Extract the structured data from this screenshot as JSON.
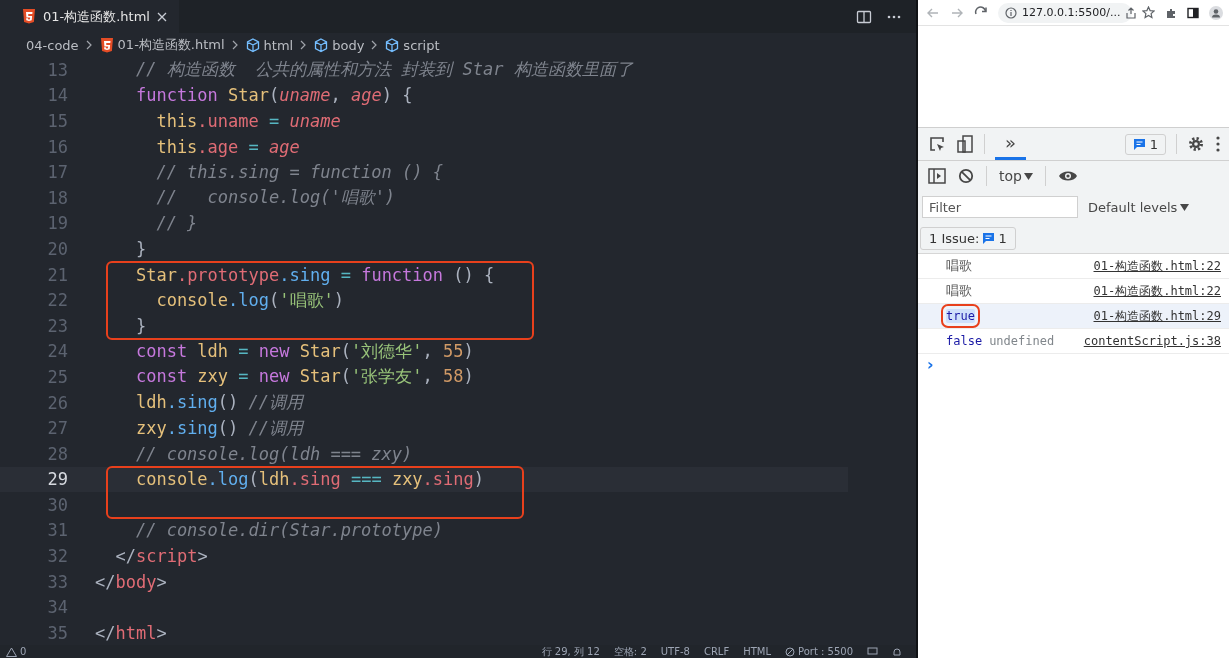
{
  "editor": {
    "tabs": [
      {
        "label": "01-构造函数.html",
        "selected": true
      }
    ],
    "breadcrumbs": [
      {
        "kind": "folder",
        "label": "04-code"
      },
      {
        "kind": "file",
        "label": "01-构造函数.html"
      },
      {
        "kind": "element",
        "label": "html"
      },
      {
        "kind": "element",
        "label": "body"
      },
      {
        "kind": "element",
        "label": "script"
      }
    ],
    "lines": [
      {
        "number": "13",
        "current": false,
        "boxed": false,
        "tokens": [
          {
            "kind": "comment",
            "text": "    // 构造函数  公共的属性和方法 封装到 Star 构造函数里面了"
          }
        ]
      },
      {
        "number": "14",
        "current": false,
        "boxed": false,
        "tokens": [
          {
            "kind": "keyword",
            "text": "    function"
          },
          {
            "kind": "class",
            "text": " Star"
          },
          {
            "kind": "punct",
            "text": "("
          },
          {
            "kind": "param",
            "text": "uname"
          },
          {
            "kind": "punct",
            "text": ", "
          },
          {
            "kind": "param",
            "text": "age"
          },
          {
            "kind": "punct",
            "text": ") {"
          }
        ]
      },
      {
        "number": "15",
        "current": false,
        "boxed": false,
        "tokens": [
          {
            "kind": "this",
            "text": "      this"
          },
          {
            "kind": "property",
            "text": ".uname"
          },
          {
            "kind": "operator",
            "text": " = "
          },
          {
            "kind": "param",
            "text": "uname"
          }
        ]
      },
      {
        "number": "16",
        "current": false,
        "boxed": false,
        "tokens": [
          {
            "kind": "this",
            "text": "      this"
          },
          {
            "kind": "property",
            "text": ".age"
          },
          {
            "kind": "operator",
            "text": " = "
          },
          {
            "kind": "param",
            "text": "age"
          }
        ]
      },
      {
        "number": "17",
        "current": false,
        "boxed": false,
        "tokens": [
          {
            "kind": "comment",
            "text": "      // this.sing = function () {"
          }
        ]
      },
      {
        "number": "18",
        "current": false,
        "boxed": false,
        "tokens": [
          {
            "kind": "comment",
            "text": "      //   console.log('唱歌')"
          }
        ]
      },
      {
        "number": "19",
        "current": false,
        "boxed": false,
        "tokens": [
          {
            "kind": "comment",
            "text": "      // }"
          }
        ]
      },
      {
        "number": "20",
        "current": false,
        "boxed": false,
        "tokens": [
          {
            "kind": "punct",
            "text": "    }"
          }
        ]
      },
      {
        "number": "21",
        "current": false,
        "boxed": true,
        "tokens": [
          {
            "kind": "class",
            "text": "    Star"
          },
          {
            "kind": "property",
            "text": ".prototype"
          },
          {
            "kind": "method",
            "text": ".sing"
          },
          {
            "kind": "operator",
            "text": " = "
          },
          {
            "kind": "keyword",
            "text": "function"
          },
          {
            "kind": "punct",
            "text": " () {"
          }
        ]
      },
      {
        "number": "22",
        "current": false,
        "boxed": true,
        "tokens": [
          {
            "kind": "variable",
            "text": "      console"
          },
          {
            "kind": "method",
            "text": ".log"
          },
          {
            "kind": "punct",
            "text": "("
          },
          {
            "kind": "string",
            "text": "'唱歌'"
          },
          {
            "kind": "punct",
            "text": ")"
          }
        ]
      },
      {
        "number": "23",
        "current": false,
        "boxed": true,
        "tokens": [
          {
            "kind": "punct",
            "text": "    }"
          }
        ]
      },
      {
        "number": "24",
        "current": false,
        "boxed": false,
        "tokens": [
          {
            "kind": "keyword",
            "text": "    const"
          },
          {
            "kind": "variable",
            "text": " ldh"
          },
          {
            "kind": "operator",
            "text": " = "
          },
          {
            "kind": "keyword",
            "text": "new"
          },
          {
            "kind": "class",
            "text": " Star"
          },
          {
            "kind": "punct",
            "text": "("
          },
          {
            "kind": "string",
            "text": "'刘德华'"
          },
          {
            "kind": "punct",
            "text": ", "
          },
          {
            "kind": "number",
            "text": "55"
          },
          {
            "kind": "punct",
            "text": ")"
          }
        ]
      },
      {
        "number": "25",
        "current": false,
        "boxed": false,
        "tokens": [
          {
            "kind": "keyword",
            "text": "    const"
          },
          {
            "kind": "variable",
            "text": " zxy"
          },
          {
            "kind": "operator",
            "text": " = "
          },
          {
            "kind": "keyword",
            "text": "new"
          },
          {
            "kind": "class",
            "text": " Star"
          },
          {
            "kind": "punct",
            "text": "("
          },
          {
            "kind": "string",
            "text": "'张学友'"
          },
          {
            "kind": "punct",
            "text": ", "
          },
          {
            "kind": "number",
            "text": "58"
          },
          {
            "kind": "punct",
            "text": ")"
          }
        ]
      },
      {
        "number": "26",
        "current": false,
        "boxed": false,
        "tokens": [
          {
            "kind": "variable",
            "text": "    ldh"
          },
          {
            "kind": "method",
            "text": ".sing"
          },
          {
            "kind": "punct",
            "text": "() "
          },
          {
            "kind": "comment",
            "text": "//调用"
          }
        ]
      },
      {
        "number": "27",
        "current": false,
        "boxed": false,
        "tokens": [
          {
            "kind": "variable",
            "text": "    zxy"
          },
          {
            "kind": "method",
            "text": ".sing"
          },
          {
            "kind": "punct",
            "text": "() "
          },
          {
            "kind": "comment",
            "text": "//调用"
          }
        ]
      },
      {
        "number": "28",
        "current": false,
        "boxed": false,
        "tokens": [
          {
            "kind": "comment",
            "text": "    // console.log(ldh === zxy)"
          }
        ]
      },
      {
        "number": "29",
        "current": true,
        "boxed": true,
        "tokens": [
          {
            "kind": "variable",
            "text": "    console"
          },
          {
            "kind": "method",
            "text": ".log"
          },
          {
            "kind": "punct",
            "text": "("
          },
          {
            "kind": "variable",
            "text": "ldh"
          },
          {
            "kind": "property",
            "text": ".sing"
          },
          {
            "kind": "operator",
            "text": " === "
          },
          {
            "kind": "variable",
            "text": "zxy"
          },
          {
            "kind": "property",
            "text": ".sing"
          },
          {
            "kind": "punct",
            "text": ")"
          }
        ]
      },
      {
        "number": "30",
        "current": false,
        "boxed": true
      },
      {
        "number": "31",
        "current": false,
        "boxed": false,
        "tokens": [
          {
            "kind": "comment",
            "text": "    // console.dir(Star.prototype)"
          }
        ]
      },
      {
        "number": "32",
        "current": false,
        "boxed": false,
        "tokens": [
          {
            "kind": "punct",
            "text": "  </"
          },
          {
            "kind": "tag",
            "text": "script"
          },
          {
            "kind": "punct",
            "text": ">"
          }
        ]
      },
      {
        "number": "33",
        "current": false,
        "boxed": false,
        "tokens": [
          {
            "kind": "punct",
            "text": "</"
          },
          {
            "kind": "tag",
            "text": "body"
          },
          {
            "kind": "punct",
            "text": ">"
          }
        ]
      },
      {
        "number": "34",
        "current": false,
        "boxed": false
      },
      {
        "number": "35",
        "current": false,
        "boxed": false,
        "tokens": [
          {
            "kind": "punct",
            "text": "</"
          },
          {
            "kind": "tag",
            "text": "html"
          },
          {
            "kind": "punct",
            "text": ">"
          }
        ]
      }
    ]
  },
  "status_bar": {
    "warnings": "0",
    "items": [
      "行 29, 列 12",
      "空格: 2",
      "UTF-8",
      "CRLF",
      "HTML"
    ],
    "port": "Port : 5500"
  },
  "browser": {
    "url": "127.0.0.1:5500/..."
  },
  "devtools": {
    "tabs": [
      {
        "label": "»",
        "selected": true
      }
    ],
    "issues_badge": "1",
    "context": "top",
    "filter": {
      "placeholder": "Filter"
    },
    "levels": "Default levels",
    "issues": {
      "label": "1 Issue:",
      "count": "1"
    },
    "messages": [
      {
        "parts": [
          {
            "kind": "text",
            "text": "唱歌"
          }
        ],
        "source": "01-构造函数.html:22",
        "selected": false,
        "boxed": false
      },
      {
        "parts": [
          {
            "kind": "text",
            "text": "唱歌"
          }
        ],
        "source": "01-构造函数.html:22",
        "selected": false,
        "boxed": false
      },
      {
        "parts": [
          {
            "kind": "boolean",
            "text": "true"
          }
        ],
        "source": "01-构造函数.html:29",
        "selected": true,
        "boxed": true
      },
      {
        "parts": [
          {
            "kind": "boolean",
            "text": "false"
          },
          {
            "kind": "undefined",
            "text": "undefined"
          }
        ],
        "source": "contentScript.js:38",
        "selected": false,
        "boxed": false
      }
    ],
    "prompt": "›"
  }
}
